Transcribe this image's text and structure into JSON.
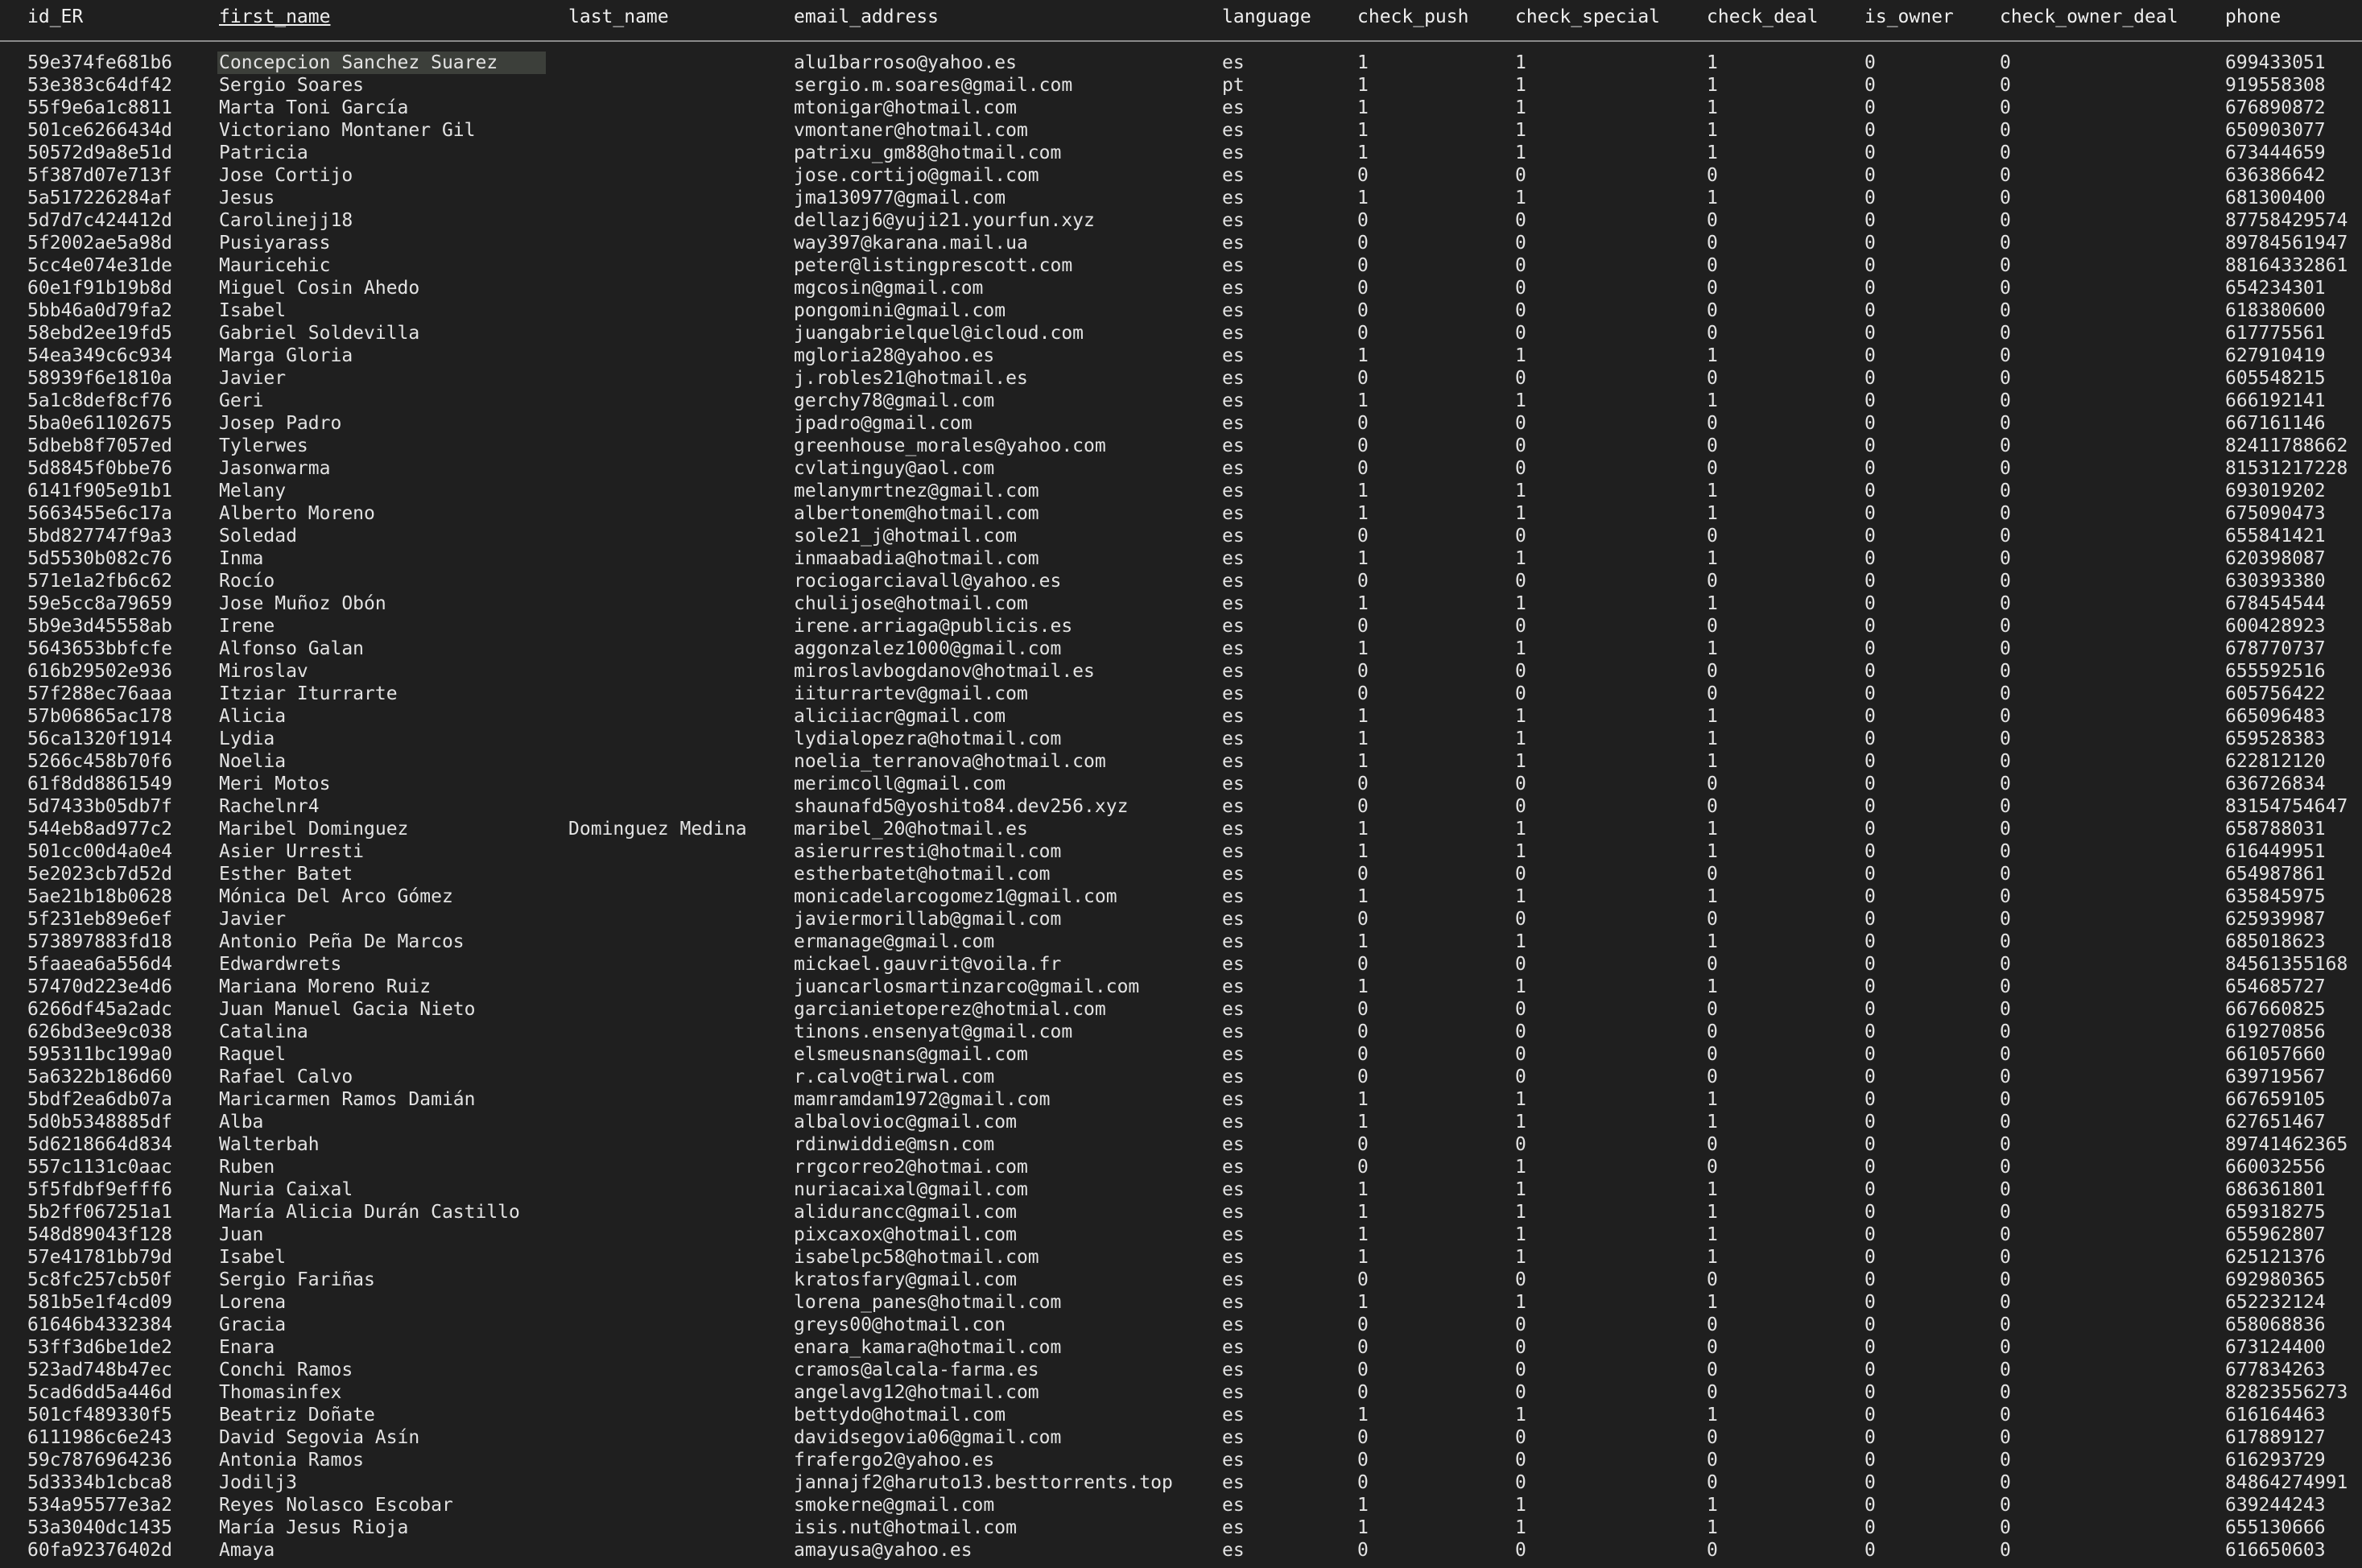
{
  "columns": [
    "id_ER",
    "first_name",
    "last_name",
    "email_address",
    "language",
    "check_push",
    "check_special",
    "check_deal",
    "is_owner",
    "check_owner_deal",
    "phone"
  ],
  "sorted_column": "first_name",
  "selected_cell": {
    "row": 0,
    "col": "first_name"
  },
  "rows": [
    [
      "59e374fe681b6",
      "Concepcion Sanchez Suarez",
      "",
      "alu1barroso@yahoo.es",
      "es",
      "1",
      "1",
      "1",
      "0",
      "0",
      "699433051"
    ],
    [
      "53e383c64df42",
      "Sergio Soares",
      "",
      "sergio.m.soares@gmail.com",
      "pt",
      "1",
      "1",
      "1",
      "0",
      "0",
      "919558308"
    ],
    [
      "55f9e6a1c8811",
      "Marta Toni García",
      "",
      "mtonigar@hotmail.com",
      "es",
      "1",
      "1",
      "1",
      "0",
      "0",
      "676890872"
    ],
    [
      "501ce6266434d",
      "Victoriano Montaner Gil",
      "",
      "vmontaner@hotmail.com",
      "es",
      "1",
      "1",
      "1",
      "0",
      "0",
      "650903077"
    ],
    [
      "50572d9a8e51d",
      "Patricia",
      "",
      "patrixu_gm88@hotmail.com",
      "es",
      "1",
      "1",
      "1",
      "0",
      "0",
      "673444659"
    ],
    [
      "5f387d07e713f",
      "Jose Cortijo",
      "",
      "jose.cortijo@gmail.com",
      "es",
      "0",
      "0",
      "0",
      "0",
      "0",
      "636386642"
    ],
    [
      "5a517226284af",
      "Jesus",
      "",
      "jma130977@gmail.com",
      "es",
      "1",
      "1",
      "1",
      "0",
      "0",
      "681300400"
    ],
    [
      "5d7d7c424412d",
      "Carolinejj18",
      "",
      "dellazj6@yuji21.yourfun.xyz",
      "es",
      "0",
      "0",
      "0",
      "0",
      "0",
      "87758429574"
    ],
    [
      "5f2002ae5a98d",
      "Pusiyarass",
      "",
      "way397@karana.mail.ua",
      "es",
      "0",
      "0",
      "0",
      "0",
      "0",
      "89784561947"
    ],
    [
      "5cc4e074e31de",
      "Mauricehic",
      "",
      "peter@listingprescott.com",
      "es",
      "0",
      "0",
      "0",
      "0",
      "0",
      "88164332861"
    ],
    [
      "60e1f91b19b8d",
      "Miguel Cosin Ahedo",
      "",
      "mgcosin@gmail.com",
      "es",
      "0",
      "0",
      "0",
      "0",
      "0",
      "654234301"
    ],
    [
      "5bb46a0d79fa2",
      "Isabel",
      "",
      "pongomini@gmail.com",
      "es",
      "0",
      "0",
      "0",
      "0",
      "0",
      "618380600"
    ],
    [
      "58ebd2ee19fd5",
      "Gabriel Soldevilla",
      "",
      "juangabrielquel@icloud.com",
      "es",
      "0",
      "0",
      "0",
      "0",
      "0",
      "617775561"
    ],
    [
      "54ea349c6c934",
      "Marga Gloria",
      "",
      "mgloria28@yahoo.es",
      "es",
      "1",
      "1",
      "1",
      "0",
      "0",
      "627910419"
    ],
    [
      "58939f6e1810a",
      "Javier",
      "",
      "j.robles21@hotmail.es",
      "es",
      "0",
      "0",
      "0",
      "0",
      "0",
      "605548215"
    ],
    [
      "5a1c8def8cf76",
      "Geri",
      "",
      "gerchy78@gmail.com",
      "es",
      "1",
      "1",
      "1",
      "0",
      "0",
      "666192141"
    ],
    [
      "5ba0e61102675",
      "Josep Padro",
      "",
      "jpadro@gmail.com",
      "es",
      "0",
      "0",
      "0",
      "0",
      "0",
      "667161146"
    ],
    [
      "5dbeb8f7057ed",
      "Tylerwes",
      "",
      "greenhouse_morales@yahoo.com",
      "es",
      "0",
      "0",
      "0",
      "0",
      "0",
      "82411788662"
    ],
    [
      "5d8845f0bbe76",
      "Jasonwarma",
      "",
      "cvlatinguy@aol.com",
      "es",
      "0",
      "0",
      "0",
      "0",
      "0",
      "81531217228"
    ],
    [
      "6141f905e91b1",
      "Melany",
      "",
      "melanymrtnez@gmail.com",
      "es",
      "1",
      "1",
      "1",
      "0",
      "0",
      "693019202"
    ],
    [
      "5663455e6c17a",
      "Alberto Moreno",
      "",
      "albertonem@hotmail.com",
      "es",
      "1",
      "1",
      "1",
      "0",
      "0",
      "675090473"
    ],
    [
      "5bd827747f9a3",
      "Soledad",
      "",
      "sole21_j@hotmail.com",
      "es",
      "0",
      "0",
      "0",
      "0",
      "0",
      "655841421"
    ],
    [
      "5d5530b082c76",
      "Inma",
      "",
      "inmaabadia@hotmail.com",
      "es",
      "1",
      "1",
      "1",
      "0",
      "0",
      "620398087"
    ],
    [
      "571e1a2fb6c62",
      "Rocío",
      "",
      "rociogarciavall@yahoo.es",
      "es",
      "0",
      "0",
      "0",
      "0",
      "0",
      "630393380"
    ],
    [
      "59e5cc8a79659",
      "Jose Muñoz Obón",
      "",
      "chulijose@hotmail.com",
      "es",
      "1",
      "1",
      "1",
      "0",
      "0",
      "678454544"
    ],
    [
      "5b9e3d45558ab",
      "Irene",
      "",
      "irene.arriaga@publicis.es",
      "es",
      "0",
      "0",
      "0",
      "0",
      "0",
      "600428923"
    ],
    [
      "5643653bbfcfe",
      "Alfonso Galan",
      "",
      "aggonzalez1000@gmail.com",
      "es",
      "1",
      "1",
      "1",
      "0",
      "0",
      "678770737"
    ],
    [
      "616b29502e936",
      "Miroslav",
      "",
      "miroslavbogdanov@hotmail.es",
      "es",
      "0",
      "0",
      "0",
      "0",
      "0",
      "655592516"
    ],
    [
      "57f288ec76aaa",
      "Itziar Iturrarte",
      "",
      "iiturrartev@gmail.com",
      "es",
      "0",
      "0",
      "0",
      "0",
      "0",
      "605756422"
    ],
    [
      "57b06865ac178",
      "Alicia",
      "",
      "aliciiacr@gmail.com",
      "es",
      "1",
      "1",
      "1",
      "0",
      "0",
      "665096483"
    ],
    [
      "56ca1320f1914",
      "Lydia",
      "",
      "lydialopezra@hotmail.com",
      "es",
      "1",
      "1",
      "1",
      "0",
      "0",
      "659528383"
    ],
    [
      "5266c458b70f6",
      "Noelia",
      "",
      "noelia_terranova@hotmail.com",
      "es",
      "1",
      "1",
      "1",
      "0",
      "0",
      "622812120"
    ],
    [
      "61f8dd8861549",
      "Meri Motos",
      "",
      "merimcoll@gmail.com",
      "es",
      "0",
      "0",
      "0",
      "0",
      "0",
      "636726834"
    ],
    [
      "5d7433b05db7f",
      "Rachelnr4",
      "",
      "shaunafd5@yoshito84.dev256.xyz",
      "es",
      "0",
      "0",
      "0",
      "0",
      "0",
      "83154754647"
    ],
    [
      "544eb8ad977c2",
      "Maribel Dominguez",
      "Dominguez Medina",
      "maribel_20@hotmail.es",
      "es",
      "1",
      "1",
      "1",
      "0",
      "0",
      "658788031"
    ],
    [
      "501cc00d4a0e4",
      "Asier Urresti",
      "",
      "asierurresti@hotmail.com",
      "es",
      "1",
      "1",
      "1",
      "0",
      "0",
      "616449951"
    ],
    [
      "5e2023cb7d52d",
      "Esther Batet",
      "",
      "estherbatet@hotmail.com",
      "es",
      "0",
      "0",
      "0",
      "0",
      "0",
      "654987861"
    ],
    [
      "5ae21b18b0628",
      "Mónica Del Arco Gómez",
      "",
      "monicadelarcogomez1@gmail.com",
      "es",
      "1",
      "1",
      "1",
      "0",
      "0",
      "635845975"
    ],
    [
      "5f231eb89e6ef",
      "Javier",
      "",
      "javiermorillab@gmail.com",
      "es",
      "0",
      "0",
      "0",
      "0",
      "0",
      "625939987"
    ],
    [
      "573897883fd18",
      "Antonio Peña De Marcos",
      "",
      "ermanage@gmail.com",
      "es",
      "1",
      "1",
      "1",
      "0",
      "0",
      "685018623"
    ],
    [
      "5faaea6a556d4",
      "Edwardwrets",
      "",
      "mickael.gauvrit@voila.fr",
      "es",
      "0",
      "0",
      "0",
      "0",
      "0",
      "84561355168"
    ],
    [
      "57470d223e4d6",
      "Mariana Moreno Ruiz",
      "",
      "juancarlosmartinzarco@gmail.com",
      "es",
      "1",
      "1",
      "1",
      "0",
      "0",
      "654685727"
    ],
    [
      "6266df45a2adc",
      "Juan Manuel Gacia Nieto",
      "",
      "garcianietoperez@hotmial.com",
      "es",
      "0",
      "0",
      "0",
      "0",
      "0",
      "667660825"
    ],
    [
      "626bd3ee9c038",
      "Catalina",
      "",
      "tinons.ensenyat@gmail.com",
      "es",
      "0",
      "0",
      "0",
      "0",
      "0",
      "619270856"
    ],
    [
      "595311bc199a0",
      "Raquel",
      "",
      "elsmeusnans@gmail.com",
      "es",
      "0",
      "0",
      "0",
      "0",
      "0",
      "661057660"
    ],
    [
      "5a6322b186d60",
      "Rafael Calvo",
      "",
      "r.calvo@tirwal.com",
      "es",
      "0",
      "0",
      "0",
      "0",
      "0",
      "639719567"
    ],
    [
      "5bdf2ea6db07a",
      "Maricarmen Ramos Damián",
      "",
      "mamramdam1972@gmail.com",
      "es",
      "1",
      "1",
      "1",
      "0",
      "0",
      "667659105"
    ],
    [
      "5d0b5348885df",
      "Alba",
      "",
      "albalovioc@gmail.com",
      "es",
      "1",
      "1",
      "1",
      "0",
      "0",
      "627651467"
    ],
    [
      "5d6218664d834",
      "Walterbah",
      "",
      "rdinwiddie@msn.com",
      "es",
      "0",
      "0",
      "0",
      "0",
      "0",
      "89741462365"
    ],
    [
      "557c1131c0aac",
      "Ruben",
      "",
      "rrgcorreo2@hotmai.com",
      "es",
      "0",
      "1",
      "0",
      "0",
      "0",
      "660032556"
    ],
    [
      "5f5fdbf9efff6",
      "Nuria Caixal",
      "",
      "nuriacaixal@gmail.com",
      "es",
      "1",
      "1",
      "1",
      "0",
      "0",
      "686361801"
    ],
    [
      "5b2ff067251a1",
      "María Alicia Durán Castillo",
      "",
      "alidurancc@gmail.com",
      "es",
      "1",
      "1",
      "1",
      "0",
      "0",
      "659318275"
    ],
    [
      "548d89043f128",
      "Juan",
      "",
      "pixcaxox@hotmail.com",
      "es",
      "1",
      "1",
      "1",
      "0",
      "0",
      "655962807"
    ],
    [
      "57e41781bb79d",
      "Isabel",
      "",
      "isabelpc58@hotmail.com",
      "es",
      "1",
      "1",
      "1",
      "0",
      "0",
      "625121376"
    ],
    [
      "5c8fc257cb50f",
      "Sergio Fariñas",
      "",
      "kratosfary@gmail.com",
      "es",
      "0",
      "0",
      "0",
      "0",
      "0",
      "692980365"
    ],
    [
      "581b5e1f4cd09",
      "Lorena",
      "",
      "lorena_panes@hotmail.com",
      "es",
      "1",
      "1",
      "1",
      "0",
      "0",
      "652232124"
    ],
    [
      "61646b4332384",
      "Gracia",
      "",
      "greys00@hotmail.con",
      "es",
      "0",
      "0",
      "0",
      "0",
      "0",
      "658068836"
    ],
    [
      "53ff3d6be1de2",
      "Enara",
      "",
      "enara_kamara@hotmail.com",
      "es",
      "0",
      "0",
      "0",
      "0",
      "0",
      "673124400"
    ],
    [
      "523ad748b47ec",
      "Conchi Ramos",
      "",
      "cramos@alcala-farma.es",
      "es",
      "0",
      "0",
      "0",
      "0",
      "0",
      "677834263"
    ],
    [
      "5cad6dd5a446d",
      "Thomasinfex",
      "",
      "angelavg12@hotmail.com",
      "es",
      "0",
      "0",
      "0",
      "0",
      "0",
      "82823556273"
    ],
    [
      "501cf489330f5",
      "Beatriz Doñate",
      "",
      "bettydo@hotmail.com",
      "es",
      "1",
      "1",
      "1",
      "0",
      "0",
      "616164463"
    ],
    [
      "6111986c6e243",
      "David Segovia Asín",
      "",
      "davidsegovia06@gmail.com",
      "es",
      "0",
      "0",
      "0",
      "0",
      "0",
      "617889127"
    ],
    [
      "59c7876964236",
      "Antonia Ramos",
      "",
      "frafergo2@yahoo.es",
      "es",
      "0",
      "0",
      "0",
      "0",
      "0",
      "616293729"
    ],
    [
      "5d3334b1cbca8",
      "Jodilj3",
      "",
      "jannajf2@haruto13.besttorrents.top",
      "es",
      "0",
      "0",
      "0",
      "0",
      "0",
      "84864274991"
    ],
    [
      "534a95577e3a2",
      "Reyes Nolasco Escobar",
      "",
      "smokerne@gmail.com",
      "es",
      "1",
      "1",
      "1",
      "0",
      "0",
      "639244243"
    ],
    [
      "53a3040dc1435",
      "María Jesus Rioja",
      "",
      "isis.nut@hotmail.com",
      "es",
      "1",
      "1",
      "1",
      "0",
      "0",
      "655130666"
    ],
    [
      "60fa92376402d",
      "Amaya",
      "",
      "amayusa@yahoo.es",
      "es",
      "0",
      "0",
      "0",
      "0",
      "0",
      "616650603"
    ]
  ]
}
